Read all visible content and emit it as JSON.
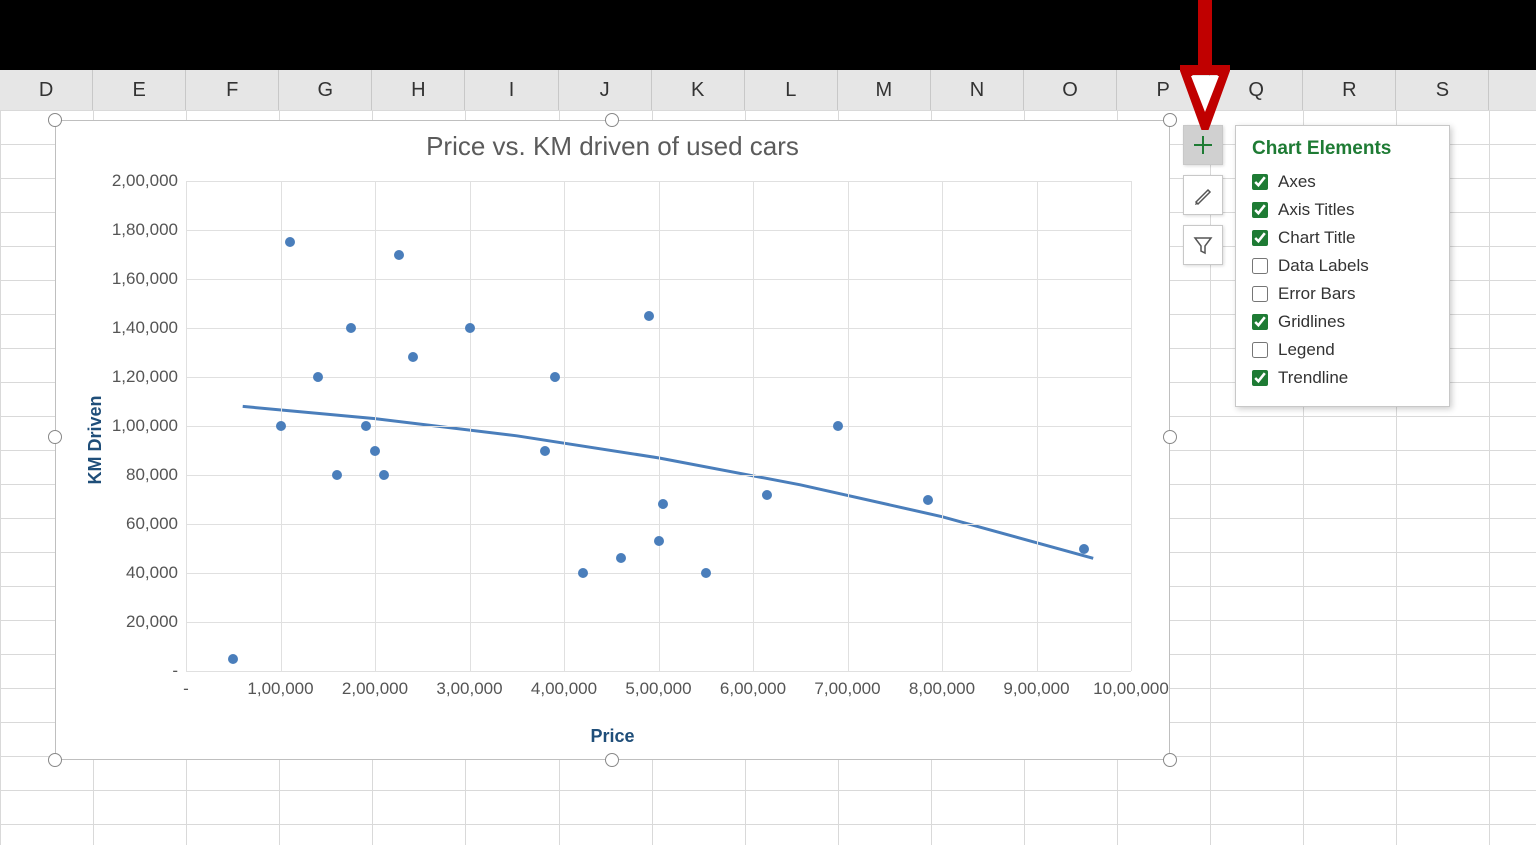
{
  "columns": [
    "D",
    "E",
    "F",
    "G",
    "H",
    "I",
    "J",
    "K",
    "L",
    "M",
    "N",
    "O",
    "P",
    "Q",
    "R",
    "S"
  ],
  "flyout": {
    "title": "Chart Elements",
    "items": [
      {
        "label": "Axes",
        "checked": true
      },
      {
        "label": "Axis Titles",
        "checked": true
      },
      {
        "label": "Chart Title",
        "checked": true
      },
      {
        "label": "Data Labels",
        "checked": false
      },
      {
        "label": "Error Bars",
        "checked": false
      },
      {
        "label": "Gridlines",
        "checked": true
      },
      {
        "label": "Legend",
        "checked": false
      },
      {
        "label": "Trendline",
        "checked": true
      }
    ]
  },
  "chart_data": {
    "type": "scatter",
    "title": "Price vs. KM driven of used cars",
    "xlabel": "Price",
    "ylabel": "KM Driven",
    "xlim": [
      0,
      1000000
    ],
    "ylim": [
      0,
      200000
    ],
    "xticks": [
      0,
      100000,
      200000,
      300000,
      400000,
      500000,
      600000,
      700000,
      800000,
      900000,
      1000000
    ],
    "xtick_labels": [
      "-",
      "1,00,000",
      "2,00,000",
      "3,00,000",
      "4,00,000",
      "5,00,000",
      "6,00,000",
      "7,00,000",
      "8,00,000",
      "9,00,000",
      "10,00,000"
    ],
    "yticks": [
      0,
      20000,
      40000,
      60000,
      80000,
      100000,
      120000,
      140000,
      160000,
      180000,
      200000
    ],
    "ytick_labels": [
      "-",
      "20,000",
      "40,000",
      "60,000",
      "80,000",
      "1,00,000",
      "1,20,000",
      "1,40,000",
      "1,60,000",
      "1,80,000",
      "2,00,000"
    ],
    "points": [
      {
        "x": 50000,
        "y": 5000
      },
      {
        "x": 100000,
        "y": 100000
      },
      {
        "x": 110000,
        "y": 175000
      },
      {
        "x": 140000,
        "y": 120000
      },
      {
        "x": 160000,
        "y": 80000
      },
      {
        "x": 175000,
        "y": 140000
      },
      {
        "x": 190000,
        "y": 100000
      },
      {
        "x": 200000,
        "y": 90000
      },
      {
        "x": 210000,
        "y": 80000
      },
      {
        "x": 225000,
        "y": 170000
      },
      {
        "x": 240000,
        "y": 128000
      },
      {
        "x": 300000,
        "y": 140000
      },
      {
        "x": 380000,
        "y": 90000
      },
      {
        "x": 390000,
        "y": 120000
      },
      {
        "x": 420000,
        "y": 40000
      },
      {
        "x": 460000,
        "y": 46000
      },
      {
        "x": 490000,
        "y": 145000
      },
      {
        "x": 500000,
        "y": 53000
      },
      {
        "x": 505000,
        "y": 68000
      },
      {
        "x": 550000,
        "y": 40000
      },
      {
        "x": 615000,
        "y": 72000
      },
      {
        "x": 690000,
        "y": 100000
      },
      {
        "x": 785000,
        "y": 70000
      },
      {
        "x": 950000,
        "y": 50000
      }
    ],
    "trendline": [
      {
        "x": 60000,
        "y": 108000
      },
      {
        "x": 200000,
        "y": 103000
      },
      {
        "x": 350000,
        "y": 96000
      },
      {
        "x": 500000,
        "y": 87000
      },
      {
        "x": 650000,
        "y": 76000
      },
      {
        "x": 800000,
        "y": 63000
      },
      {
        "x": 960000,
        "y": 46000
      }
    ]
  }
}
